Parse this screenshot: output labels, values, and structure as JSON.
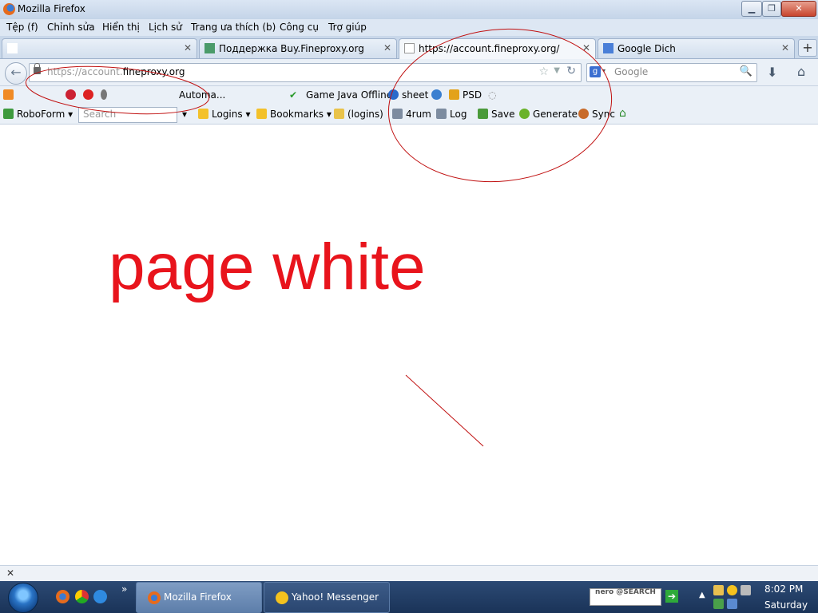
{
  "window": {
    "title": "Mozilla Firefox",
    "min": "▁",
    "max": "❐",
    "close": "✕"
  },
  "menu": [
    "Tệp (f)",
    "Chỉnh sửa",
    "Hiển thị",
    "Lịch sử",
    "Trang ưa thích (b)",
    "Công cụ",
    "Trợ giúp"
  ],
  "tabs": [
    {
      "label": "",
      "icon": "redacted-icon",
      "close": "✕"
    },
    {
      "label": "Поддержка Buy.Fineproxy.org",
      "icon": "site-icon",
      "close": "✕"
    },
    {
      "label": "https://account.fineproxy.org/",
      "icon": "blank-page-icon",
      "close": "✕"
    },
    {
      "label": "Google Dich",
      "icon": "google-translate-icon",
      "close": "✕"
    }
  ],
  "new_tab": "+",
  "nav": {
    "back": "←",
    "url_prefix": "https://account.",
    "url_domain": "fineproxy.org",
    "star": "☆",
    "dropdown": "▼",
    "reload": "↻",
    "search_engine": "g",
    "search_placeholder": "Google",
    "search_icon": "🔍",
    "download": "⬇",
    "home": "⌂"
  },
  "bookmarks": [
    "Automa...",
    "Game Java Offline",
    "sheet",
    "PSD"
  ],
  "robobar": {
    "roboform": "RoboForm ▾",
    "search_placeholder": "Search",
    "logins": "Logins ▾",
    "bookmarks": "Bookmarks ▾",
    "logins_paren": "(logins)",
    "forum": "4rum",
    "log": "Log",
    "save": "Save",
    "generate": "Generate",
    "sync": "Sync"
  },
  "content": {
    "annotation": "page white"
  },
  "findbar": {
    "close": "✕"
  },
  "taskbar": {
    "more": "»",
    "tasks": [
      {
        "label": "Mozilla Firefox"
      },
      {
        "label": "Yahoo! Messenger"
      }
    ],
    "nero": "nero @SEARCH",
    "nero_go": "➔",
    "tray_up": "▲",
    "time": "8:02 PM",
    "day": "Saturday"
  },
  "colors": {
    "annotation": "#e8141c",
    "taskbar": "#1a3358",
    "accent": "#3c6fd1"
  }
}
